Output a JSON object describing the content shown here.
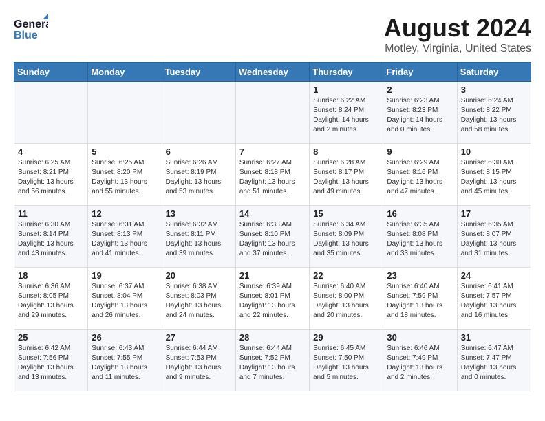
{
  "app": {
    "logo_line1": "General",
    "logo_line2": "Blue"
  },
  "header": {
    "title": "August 2024",
    "subtitle": "Motley, Virginia, United States"
  },
  "days_of_week": [
    "Sunday",
    "Monday",
    "Tuesday",
    "Wednesday",
    "Thursday",
    "Friday",
    "Saturday"
  ],
  "weeks": [
    [
      {
        "day": "",
        "content": ""
      },
      {
        "day": "",
        "content": ""
      },
      {
        "day": "",
        "content": ""
      },
      {
        "day": "",
        "content": ""
      },
      {
        "day": "1",
        "content": "Sunrise: 6:22 AM\nSunset: 8:24 PM\nDaylight: 14 hours\nand 2 minutes."
      },
      {
        "day": "2",
        "content": "Sunrise: 6:23 AM\nSunset: 8:23 PM\nDaylight: 14 hours\nand 0 minutes."
      },
      {
        "day": "3",
        "content": "Sunrise: 6:24 AM\nSunset: 8:22 PM\nDaylight: 13 hours\nand 58 minutes."
      }
    ],
    [
      {
        "day": "4",
        "content": "Sunrise: 6:25 AM\nSunset: 8:21 PM\nDaylight: 13 hours\nand 56 minutes."
      },
      {
        "day": "5",
        "content": "Sunrise: 6:25 AM\nSunset: 8:20 PM\nDaylight: 13 hours\nand 55 minutes."
      },
      {
        "day": "6",
        "content": "Sunrise: 6:26 AM\nSunset: 8:19 PM\nDaylight: 13 hours\nand 53 minutes."
      },
      {
        "day": "7",
        "content": "Sunrise: 6:27 AM\nSunset: 8:18 PM\nDaylight: 13 hours\nand 51 minutes."
      },
      {
        "day": "8",
        "content": "Sunrise: 6:28 AM\nSunset: 8:17 PM\nDaylight: 13 hours\nand 49 minutes."
      },
      {
        "day": "9",
        "content": "Sunrise: 6:29 AM\nSunset: 8:16 PM\nDaylight: 13 hours\nand 47 minutes."
      },
      {
        "day": "10",
        "content": "Sunrise: 6:30 AM\nSunset: 8:15 PM\nDaylight: 13 hours\nand 45 minutes."
      }
    ],
    [
      {
        "day": "11",
        "content": "Sunrise: 6:30 AM\nSunset: 8:14 PM\nDaylight: 13 hours\nand 43 minutes."
      },
      {
        "day": "12",
        "content": "Sunrise: 6:31 AM\nSunset: 8:13 PM\nDaylight: 13 hours\nand 41 minutes."
      },
      {
        "day": "13",
        "content": "Sunrise: 6:32 AM\nSunset: 8:11 PM\nDaylight: 13 hours\nand 39 minutes."
      },
      {
        "day": "14",
        "content": "Sunrise: 6:33 AM\nSunset: 8:10 PM\nDaylight: 13 hours\nand 37 minutes."
      },
      {
        "day": "15",
        "content": "Sunrise: 6:34 AM\nSunset: 8:09 PM\nDaylight: 13 hours\nand 35 minutes."
      },
      {
        "day": "16",
        "content": "Sunrise: 6:35 AM\nSunset: 8:08 PM\nDaylight: 13 hours\nand 33 minutes."
      },
      {
        "day": "17",
        "content": "Sunrise: 6:35 AM\nSunset: 8:07 PM\nDaylight: 13 hours\nand 31 minutes."
      }
    ],
    [
      {
        "day": "18",
        "content": "Sunrise: 6:36 AM\nSunset: 8:05 PM\nDaylight: 13 hours\nand 29 minutes."
      },
      {
        "day": "19",
        "content": "Sunrise: 6:37 AM\nSunset: 8:04 PM\nDaylight: 13 hours\nand 26 minutes."
      },
      {
        "day": "20",
        "content": "Sunrise: 6:38 AM\nSunset: 8:03 PM\nDaylight: 13 hours\nand 24 minutes."
      },
      {
        "day": "21",
        "content": "Sunrise: 6:39 AM\nSunset: 8:01 PM\nDaylight: 13 hours\nand 22 minutes."
      },
      {
        "day": "22",
        "content": "Sunrise: 6:40 AM\nSunset: 8:00 PM\nDaylight: 13 hours\nand 20 minutes."
      },
      {
        "day": "23",
        "content": "Sunrise: 6:40 AM\nSunset: 7:59 PM\nDaylight: 13 hours\nand 18 minutes."
      },
      {
        "day": "24",
        "content": "Sunrise: 6:41 AM\nSunset: 7:57 PM\nDaylight: 13 hours\nand 16 minutes."
      }
    ],
    [
      {
        "day": "25",
        "content": "Sunrise: 6:42 AM\nSunset: 7:56 PM\nDaylight: 13 hours\nand 13 minutes."
      },
      {
        "day": "26",
        "content": "Sunrise: 6:43 AM\nSunset: 7:55 PM\nDaylight: 13 hours\nand 11 minutes."
      },
      {
        "day": "27",
        "content": "Sunrise: 6:44 AM\nSunset: 7:53 PM\nDaylight: 13 hours\nand 9 minutes."
      },
      {
        "day": "28",
        "content": "Sunrise: 6:44 AM\nSunset: 7:52 PM\nDaylight: 13 hours\nand 7 minutes."
      },
      {
        "day": "29",
        "content": "Sunrise: 6:45 AM\nSunset: 7:50 PM\nDaylight: 13 hours\nand 5 minutes."
      },
      {
        "day": "30",
        "content": "Sunrise: 6:46 AM\nSunset: 7:49 PM\nDaylight: 13 hours\nand 2 minutes."
      },
      {
        "day": "31",
        "content": "Sunrise: 6:47 AM\nSunset: 7:47 PM\nDaylight: 13 hours\nand 0 minutes."
      }
    ]
  ]
}
